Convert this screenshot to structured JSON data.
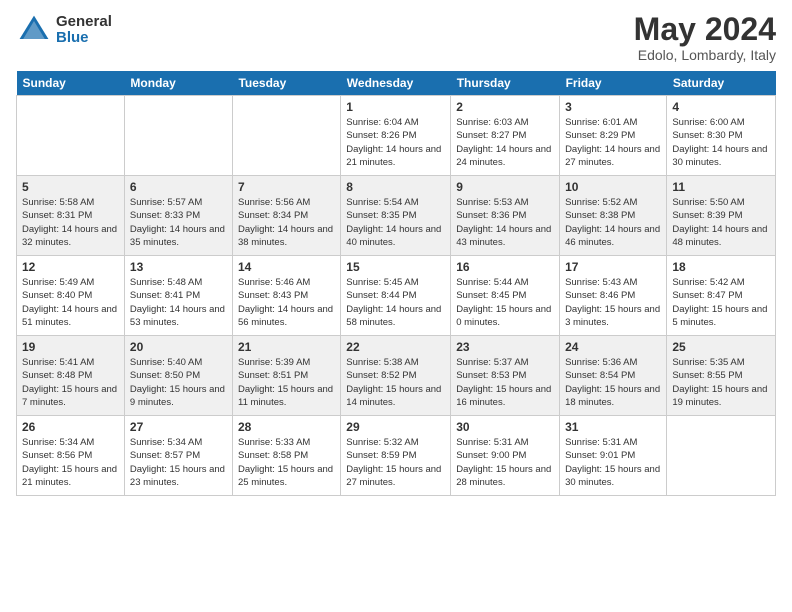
{
  "logo": {
    "general": "General",
    "blue": "Blue"
  },
  "title": "May 2024",
  "location": "Edolo, Lombardy, Italy",
  "days_of_week": [
    "Sunday",
    "Monday",
    "Tuesday",
    "Wednesday",
    "Thursday",
    "Friday",
    "Saturday"
  ],
  "weeks": [
    [
      {
        "num": "",
        "info": ""
      },
      {
        "num": "",
        "info": ""
      },
      {
        "num": "",
        "info": ""
      },
      {
        "num": "1",
        "info": "Sunrise: 6:04 AM\nSunset: 8:26 PM\nDaylight: 14 hours\nand 21 minutes."
      },
      {
        "num": "2",
        "info": "Sunrise: 6:03 AM\nSunset: 8:27 PM\nDaylight: 14 hours\nand 24 minutes."
      },
      {
        "num": "3",
        "info": "Sunrise: 6:01 AM\nSunset: 8:29 PM\nDaylight: 14 hours\nand 27 minutes."
      },
      {
        "num": "4",
        "info": "Sunrise: 6:00 AM\nSunset: 8:30 PM\nDaylight: 14 hours\nand 30 minutes."
      }
    ],
    [
      {
        "num": "5",
        "info": "Sunrise: 5:58 AM\nSunset: 8:31 PM\nDaylight: 14 hours\nand 32 minutes."
      },
      {
        "num": "6",
        "info": "Sunrise: 5:57 AM\nSunset: 8:33 PM\nDaylight: 14 hours\nand 35 minutes."
      },
      {
        "num": "7",
        "info": "Sunrise: 5:56 AM\nSunset: 8:34 PM\nDaylight: 14 hours\nand 38 minutes."
      },
      {
        "num": "8",
        "info": "Sunrise: 5:54 AM\nSunset: 8:35 PM\nDaylight: 14 hours\nand 40 minutes."
      },
      {
        "num": "9",
        "info": "Sunrise: 5:53 AM\nSunset: 8:36 PM\nDaylight: 14 hours\nand 43 minutes."
      },
      {
        "num": "10",
        "info": "Sunrise: 5:52 AM\nSunset: 8:38 PM\nDaylight: 14 hours\nand 46 minutes."
      },
      {
        "num": "11",
        "info": "Sunrise: 5:50 AM\nSunset: 8:39 PM\nDaylight: 14 hours\nand 48 minutes."
      }
    ],
    [
      {
        "num": "12",
        "info": "Sunrise: 5:49 AM\nSunset: 8:40 PM\nDaylight: 14 hours\nand 51 minutes."
      },
      {
        "num": "13",
        "info": "Sunrise: 5:48 AM\nSunset: 8:41 PM\nDaylight: 14 hours\nand 53 minutes."
      },
      {
        "num": "14",
        "info": "Sunrise: 5:46 AM\nSunset: 8:43 PM\nDaylight: 14 hours\nand 56 minutes."
      },
      {
        "num": "15",
        "info": "Sunrise: 5:45 AM\nSunset: 8:44 PM\nDaylight: 14 hours\nand 58 minutes."
      },
      {
        "num": "16",
        "info": "Sunrise: 5:44 AM\nSunset: 8:45 PM\nDaylight: 15 hours\nand 0 minutes."
      },
      {
        "num": "17",
        "info": "Sunrise: 5:43 AM\nSunset: 8:46 PM\nDaylight: 15 hours\nand 3 minutes."
      },
      {
        "num": "18",
        "info": "Sunrise: 5:42 AM\nSunset: 8:47 PM\nDaylight: 15 hours\nand 5 minutes."
      }
    ],
    [
      {
        "num": "19",
        "info": "Sunrise: 5:41 AM\nSunset: 8:48 PM\nDaylight: 15 hours\nand 7 minutes."
      },
      {
        "num": "20",
        "info": "Sunrise: 5:40 AM\nSunset: 8:50 PM\nDaylight: 15 hours\nand 9 minutes."
      },
      {
        "num": "21",
        "info": "Sunrise: 5:39 AM\nSunset: 8:51 PM\nDaylight: 15 hours\nand 11 minutes."
      },
      {
        "num": "22",
        "info": "Sunrise: 5:38 AM\nSunset: 8:52 PM\nDaylight: 15 hours\nand 14 minutes."
      },
      {
        "num": "23",
        "info": "Sunrise: 5:37 AM\nSunset: 8:53 PM\nDaylight: 15 hours\nand 16 minutes."
      },
      {
        "num": "24",
        "info": "Sunrise: 5:36 AM\nSunset: 8:54 PM\nDaylight: 15 hours\nand 18 minutes."
      },
      {
        "num": "25",
        "info": "Sunrise: 5:35 AM\nSunset: 8:55 PM\nDaylight: 15 hours\nand 19 minutes."
      }
    ],
    [
      {
        "num": "26",
        "info": "Sunrise: 5:34 AM\nSunset: 8:56 PM\nDaylight: 15 hours\nand 21 minutes."
      },
      {
        "num": "27",
        "info": "Sunrise: 5:34 AM\nSunset: 8:57 PM\nDaylight: 15 hours\nand 23 minutes."
      },
      {
        "num": "28",
        "info": "Sunrise: 5:33 AM\nSunset: 8:58 PM\nDaylight: 15 hours\nand 25 minutes."
      },
      {
        "num": "29",
        "info": "Sunrise: 5:32 AM\nSunset: 8:59 PM\nDaylight: 15 hours\nand 27 minutes."
      },
      {
        "num": "30",
        "info": "Sunrise: 5:31 AM\nSunset: 9:00 PM\nDaylight: 15 hours\nand 28 minutes."
      },
      {
        "num": "31",
        "info": "Sunrise: 5:31 AM\nSunset: 9:01 PM\nDaylight: 15 hours\nand 30 minutes."
      },
      {
        "num": "",
        "info": ""
      }
    ]
  ]
}
